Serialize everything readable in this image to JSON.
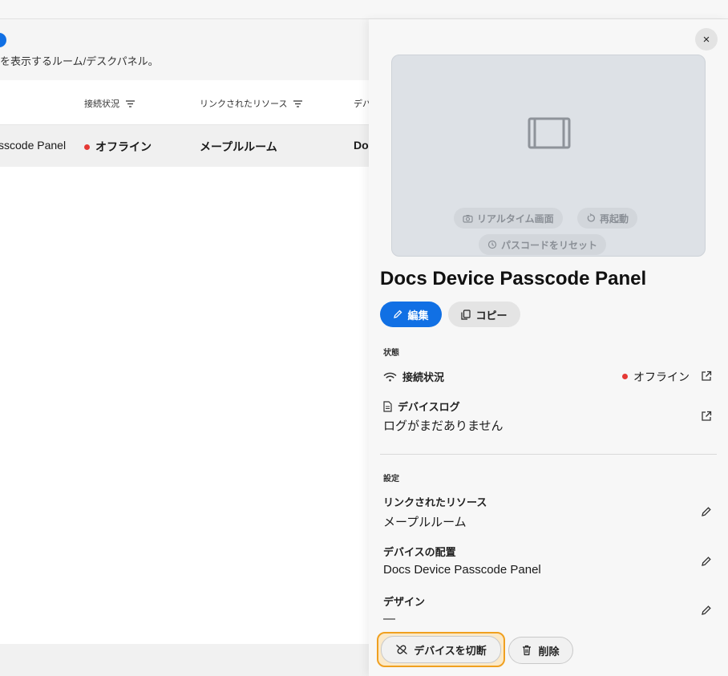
{
  "left": {
    "subtitle": "を表示するルーム/デスクパネル。",
    "columns": [
      {
        "label": "接続状況"
      },
      {
        "label": "リンクされたリソース"
      },
      {
        "label": "デバ"
      }
    ],
    "row": {
      "name": "sscode Panel",
      "status": "オフライン",
      "resource": "メープルルーム",
      "placement": "Doc"
    }
  },
  "panel": {
    "close_label": "×",
    "preview": {
      "realtime_label": "リアルタイム画面",
      "restart_label": "再起動",
      "reset_passcode_label": "パスコードをリセット"
    },
    "title": "Docs Device Passcode Panel",
    "edit_label": "編集",
    "copy_label": "コピー",
    "state_section": "状態",
    "connection_label": "接続状況",
    "connection_value": "オフライン",
    "log_label": "デバイスログ",
    "log_value": "ログがまだありません",
    "settings_section": "設定",
    "linked_resource_label": "リンクされたリソース",
    "linked_resource_value": "メープルルーム",
    "placement_label": "デバイスの配置",
    "placement_value": "Docs Device Passcode Panel",
    "design_label": "デザイン",
    "design_value": "—",
    "disconnect_label": "デバイスを切断",
    "delete_label": "削除"
  },
  "colors": {
    "accent": "#1170e4",
    "offline": "#e53935",
    "highlight": "#f0a020"
  },
  "icons": [
    "filter-icon",
    "close-icon",
    "screen-icon",
    "camera-icon",
    "restart-icon",
    "reset-icon",
    "pencil-icon",
    "copy-icon",
    "wifi-icon",
    "document-icon",
    "external-link-icon",
    "unlink-icon",
    "trash-icon"
  ]
}
